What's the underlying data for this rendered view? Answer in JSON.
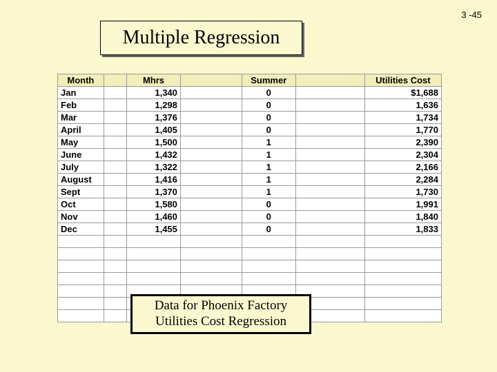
{
  "page_number": "3 -45",
  "title": "Multiple Regression",
  "caption": "Data for Phoenix Factory Utilities Cost Regression",
  "headers": {
    "month": "Month",
    "mhrs": "Mhrs",
    "summer": "Summer",
    "cost": "Utilities Cost"
  },
  "rows": [
    {
      "month": "Jan",
      "mhrs": "1,340",
      "summer": "0",
      "cost": "$1,688"
    },
    {
      "month": "Feb",
      "mhrs": "1,298",
      "summer": "0",
      "cost": "1,636"
    },
    {
      "month": "Mar",
      "mhrs": "1,376",
      "summer": "0",
      "cost": "1,734"
    },
    {
      "month": "April",
      "mhrs": "1,405",
      "summer": "0",
      "cost": "1,770"
    },
    {
      "month": "May",
      "mhrs": "1,500",
      "summer": "1",
      "cost": "2,390"
    },
    {
      "month": "June",
      "mhrs": "1,432",
      "summer": "1",
      "cost": "2,304"
    },
    {
      "month": "July",
      "mhrs": "1,322",
      "summer": "1",
      "cost": "2,166"
    },
    {
      "month": "August",
      "mhrs": "1,416",
      "summer": "1",
      "cost": "2,284"
    },
    {
      "month": "Sept",
      "mhrs": "1,370",
      "summer": "1",
      "cost": "1,730"
    },
    {
      "month": "Oct",
      "mhrs": "1,580",
      "summer": "0",
      "cost": "1,991"
    },
    {
      "month": "Nov",
      "mhrs": "1,460",
      "summer": "0",
      "cost": "1,840"
    },
    {
      "month": "Dec",
      "mhrs": "1,455",
      "summer": "0",
      "cost": "1,833"
    }
  ],
  "chart_data": {
    "type": "table",
    "title": "Data for Phoenix Factory Utilities Cost Regression",
    "columns": [
      "Month",
      "Mhrs",
      "Summer",
      "Utilities Cost"
    ],
    "data": [
      [
        "Jan",
        1340,
        0,
        1688
      ],
      [
        "Feb",
        1298,
        0,
        1636
      ],
      [
        "Mar",
        1376,
        0,
        1734
      ],
      [
        "April",
        1405,
        0,
        1770
      ],
      [
        "May",
        1500,
        1,
        2390
      ],
      [
        "June",
        1432,
        1,
        2304
      ],
      [
        "July",
        1322,
        1,
        2166
      ],
      [
        "August",
        1416,
        1,
        2284
      ],
      [
        "Sept",
        1370,
        1,
        1730
      ],
      [
        "Oct",
        1580,
        0,
        1991
      ],
      [
        "Nov",
        1460,
        0,
        1840
      ],
      [
        "Dec",
        1455,
        0,
        1833
      ]
    ]
  }
}
